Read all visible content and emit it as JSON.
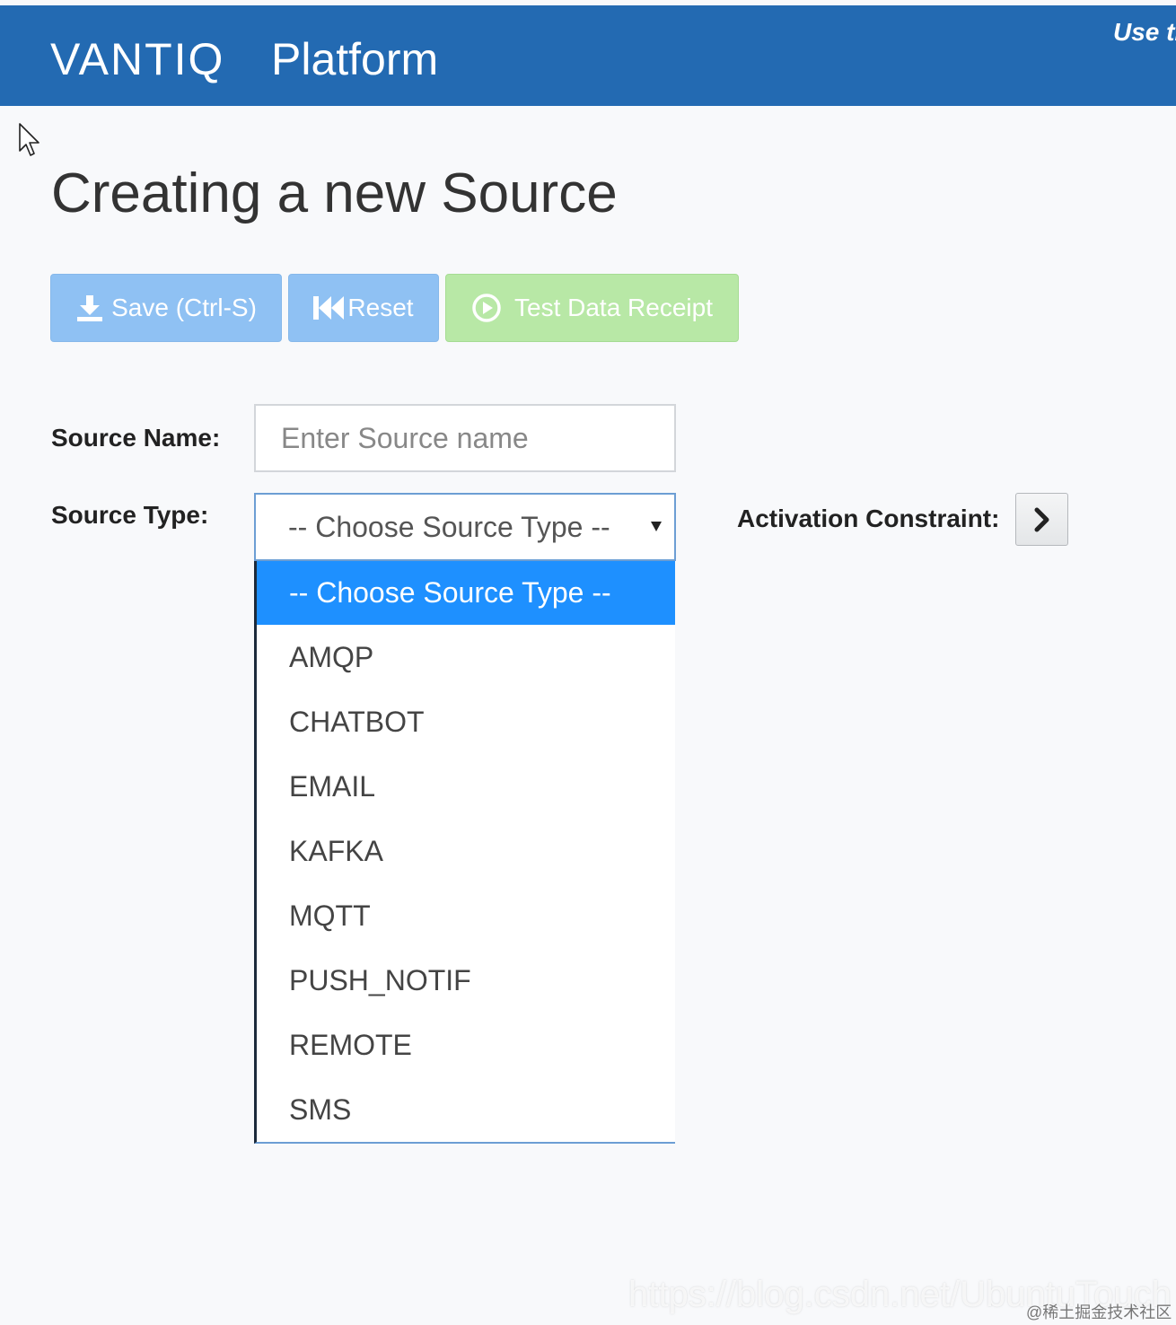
{
  "header": {
    "logo_text": "VANTIQ",
    "platform_label": "Platform",
    "user_link": "Use th"
  },
  "page": {
    "title": "Creating a new Source"
  },
  "toolbar": {
    "save_label": "Save (Ctrl-S)",
    "reset_label": "Reset",
    "test_label": "Test Data Receipt"
  },
  "form": {
    "source_name_label": "Source Name:",
    "source_name_placeholder": "Enter Source name",
    "source_type_label": "Source Type:",
    "source_type_selected": "-- Choose Source Type --",
    "activation_constraint_label": "Activation Constraint:"
  },
  "source_type_options": [
    "-- Choose Source Type --",
    "AMQP",
    "CHATBOT",
    "EMAIL",
    "KAFKA",
    "MQTT",
    "PUSH_NOTIF",
    "REMOTE",
    "SMS"
  ],
  "watermark": {
    "url": "https://blog.csdn.net/UbuntuTouch",
    "community": "@稀土掘金技术社区"
  },
  "colors": {
    "header_bg": "#236ab2",
    "primary_button": "#8fc1f3",
    "success_button": "#b8e8a6",
    "selected_option": "#1e90ff"
  },
  "icons": {
    "save": "download-icon",
    "reset": "fast-backward-icon",
    "test": "play-circle-icon",
    "activation": "chevron-right-icon"
  }
}
